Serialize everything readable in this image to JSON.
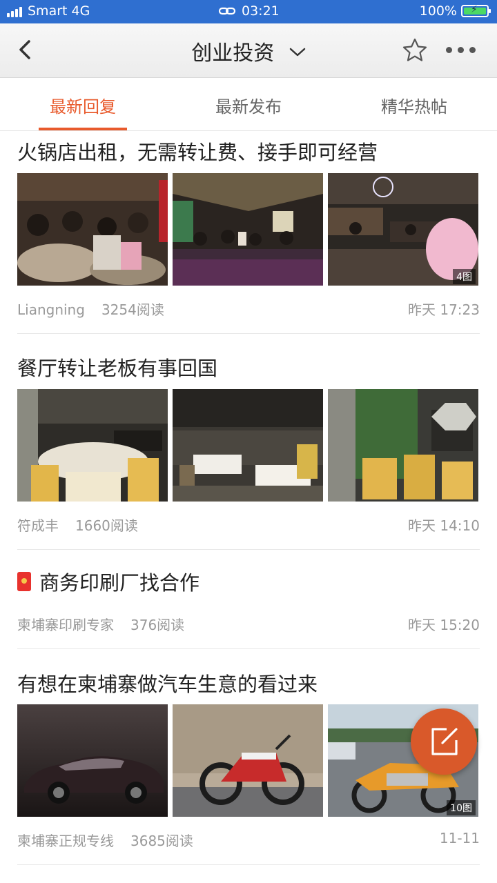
{
  "status_bar": {
    "carrier": "Smart 4G",
    "time": "03:21",
    "battery": "100%",
    "battery_level": 1.0
  },
  "nav": {
    "title": "创业投资"
  },
  "tabs": [
    {
      "label": "最新回复",
      "active": true
    },
    {
      "label": "最新发布",
      "active": false
    },
    {
      "label": "精华热帖",
      "active": false
    }
  ],
  "posts": [
    {
      "title": "火锅店出租，无需转让费、接手即可经营",
      "author": "Liangning",
      "reads": "3254阅读",
      "time": "昨天 17:23",
      "image_count": "4图",
      "images": [
        "hotpot-dining-photo",
        "restaurant-interior-photo",
        "restaurant-hall-photo"
      ]
    },
    {
      "title": "餐厅转让老板有事回国",
      "author": "符成丰",
      "reads": "1660阅读",
      "time": "昨天 14:10",
      "images": [
        "banquet-hall-photo",
        "dining-room-photo",
        "green-wall-dining-photo"
      ]
    },
    {
      "title": "商务印刷厂找合作",
      "author": "柬埔寨印刷专家",
      "reads": "376阅读",
      "time": "昨天 15:20",
      "icon": "red-packet-icon"
    },
    {
      "title": "有想在柬埔寨做汽车生意的看过来",
      "author": "柬埔寨正规专线",
      "reads": "3685阅读",
      "time": "11-11",
      "image_count": "10图",
      "images": [
        "concept-car-photo",
        "dirt-bike-photo",
        "orange-motorcycle-photo"
      ]
    }
  ],
  "colors": {
    "accent": "#e85a2c",
    "status_bar": "#2f6fd0",
    "fab": "#d9592a"
  },
  "icons": [
    "back-chevron-icon",
    "dropdown-chevron-icon",
    "star-icon",
    "more-dots-icon",
    "compose-icon",
    "link-icon",
    "signal-icon",
    "battery-icon"
  ]
}
